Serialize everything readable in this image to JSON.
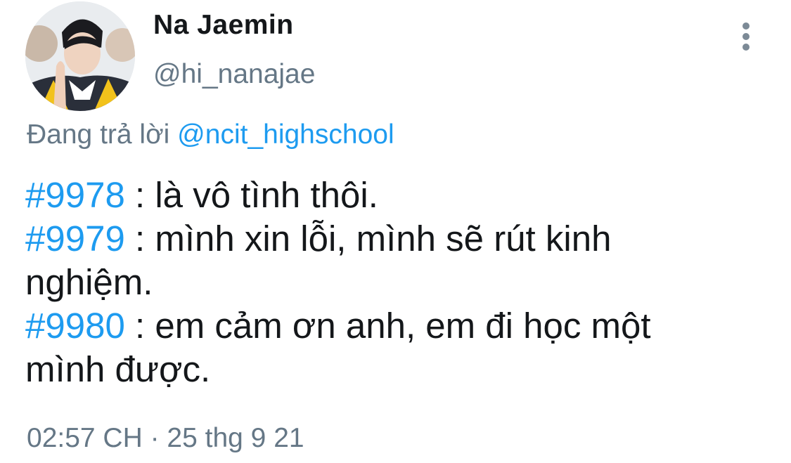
{
  "author": {
    "display_name": "Na Jaemin",
    "handle": "@hi_nanajae",
    "avatar_icon": "profile-photo"
  },
  "more_icon": "vertical-ellipsis-icon",
  "reply": {
    "prefix": "Đang trả lời",
    "mention": "@ncit_highschool"
  },
  "tweet": {
    "lines": [
      {
        "hashtag": "#9978",
        "text": " : là vô tình thôi."
      },
      {
        "hashtag": "#9979",
        "text": " : mình xin lỗi, mình sẽ rút kinh"
      },
      {
        "hashtag": "",
        "text": "nghiệm."
      },
      {
        "hashtag": "#9980",
        "text": " : em cảm ơn anh, em đi học một"
      },
      {
        "hashtag": "",
        "text": "mình được."
      }
    ]
  },
  "timestamp": "02:57 CH · 25 thg 9 21",
  "colors": {
    "link": "#1d9bf0",
    "secondary_text": "#657786",
    "primary_text": "#14171a"
  }
}
